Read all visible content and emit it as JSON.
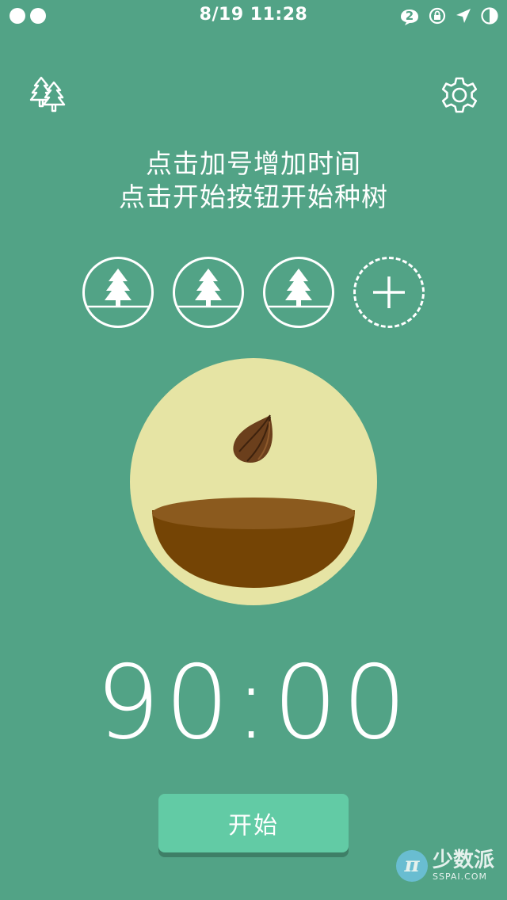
{
  "status_bar": {
    "time": "8/19 11:28",
    "notification_count": "2",
    "icons": [
      "message-bubble-icon",
      "rotation-lock-icon",
      "location-arrow-icon",
      "battery-icon"
    ]
  },
  "header": {
    "left_icon": "forest-icon",
    "right_icon": "gear-icon"
  },
  "instructions": {
    "line1": "点击加号增加时间",
    "line2": "点击开始按钮开始种树"
  },
  "tree_slots": [
    {
      "type": "tree",
      "icon": "tree-icon"
    },
    {
      "type": "tree",
      "icon": "tree-icon"
    },
    {
      "type": "tree",
      "icon": "tree-icon"
    },
    {
      "type": "add",
      "icon": "plus-icon"
    }
  ],
  "pot": {
    "icons": [
      "seed-icon",
      "soil-bowl-icon"
    ]
  },
  "timer": {
    "value": "90:00"
  },
  "actions": {
    "start_label": "开始"
  },
  "watermark": {
    "cn": "少数派",
    "en": "SSPAI.COM",
    "logo": "π"
  },
  "colors": {
    "background": "#52A386",
    "pot_circle": "#E6E4A4",
    "soil_top": "#8B5A1E",
    "soil_bowl": "#744405",
    "seed": "#6B3F1C",
    "button": "#62CBA5"
  }
}
